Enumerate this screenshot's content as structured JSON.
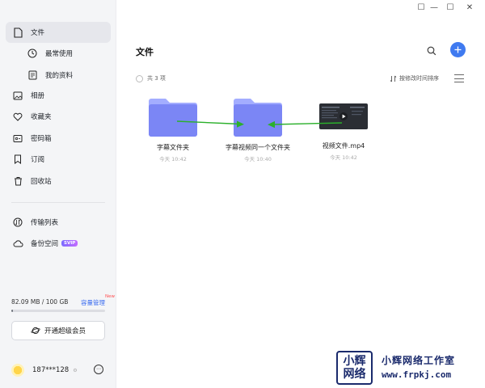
{
  "window": {
    "controls": [
      "☐",
      "—",
      "☐",
      "✕"
    ]
  },
  "sidebar": {
    "items": [
      {
        "label": "文件",
        "icon": "file-icon",
        "active": true
      },
      {
        "label": "最常使用",
        "icon": "clock-icon"
      },
      {
        "label": "我的资料",
        "icon": "doc-icon"
      },
      {
        "label": "相册",
        "icon": "image-icon"
      },
      {
        "label": "收藏夹",
        "icon": "heart-icon"
      },
      {
        "label": "密码箱",
        "icon": "safe-icon"
      },
      {
        "label": "订阅",
        "icon": "bookmark-icon"
      },
      {
        "label": "回收站",
        "icon": "trash-icon"
      },
      {
        "label": "传输列表",
        "icon": "transfer-icon"
      },
      {
        "label": "备份空间",
        "icon": "cloud-icon",
        "badge": "SVIP"
      }
    ],
    "storage": {
      "usage": "82.09 MB / 100 GB",
      "manage": "容量管理",
      "new_badge": "New",
      "used_fraction": 0.0008
    },
    "vip_button": "开通超级会员",
    "user": {
      "name": "187***128",
      "gear": "⚙",
      "more": "⋯"
    }
  },
  "main": {
    "title": "文件",
    "count": "共 3 项",
    "sort": "按修改时间排序",
    "files": [
      {
        "name": "字幕文件夹",
        "date": "今天 10:42",
        "type": "folder"
      },
      {
        "name": "字幕视频同一个文件夹",
        "date": "今天 10:40",
        "type": "folder"
      },
      {
        "name": "视频文件.mp4",
        "date": "今天 10:42",
        "type": "video"
      }
    ]
  },
  "watermark": {
    "logo_top": "小辉",
    "logo_bottom": "网络",
    "title": "小辉网络工作室",
    "url": "www.frpkj.com"
  },
  "colors": {
    "accent": "#3f7af0",
    "folder": "#7b86f5",
    "arrow": "#2bb02b",
    "watermark": "#1a2a6c"
  }
}
